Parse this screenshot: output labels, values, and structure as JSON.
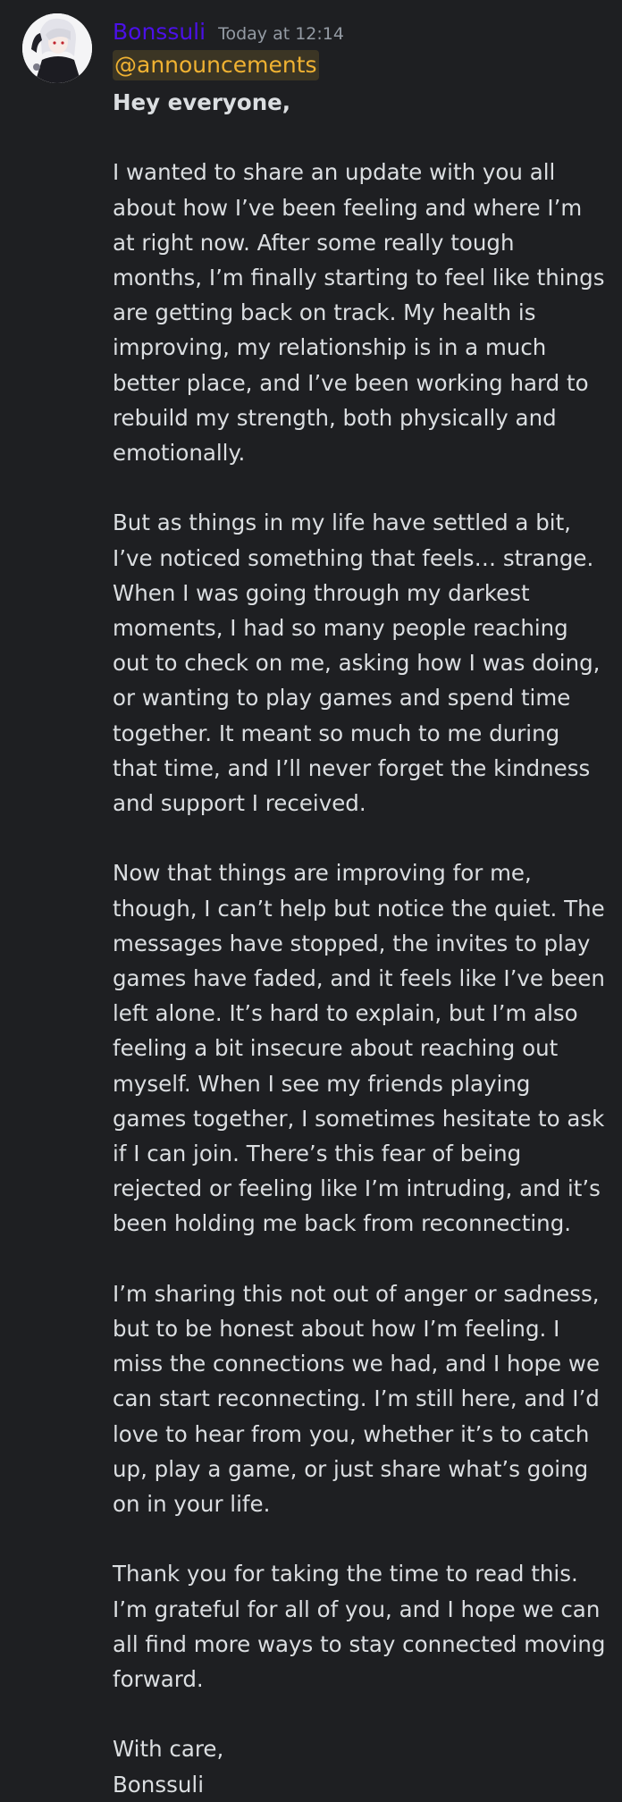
{
  "message": {
    "author": "Bonssuli",
    "timestamp": "Today at 12:14",
    "mention": "@announcements",
    "greeting": "Hey everyone,",
    "paragraphs": [
      "I wanted to share an update with you all about how I’ve been feeling and where I’m at right now. After some really tough months, I’m finally starting to feel like things are getting back on track. My health is improving, my relationship is in a much better place, and I’ve been working hard to rebuild my strength, both physically and emotionally.",
      "But as things in my life have settled a bit, I’ve noticed something that feels… strange. When I was going through my darkest moments, I had so many people reaching out to check on me, asking how I was doing, or wanting to play games and spend time together. It meant so much to me during that time, and I’ll never forget the kindness and support I received.",
      "Now that things are improving for me, though, I can’t help but notice the quiet. The messages have stopped, the invites to play games have faded, and it feels like I’ve been left alone. It’s hard to explain, but I’m also feeling a bit insecure about reaching out myself. When I see my friends playing games together, I sometimes hesitate to ask if I can join. There’s this fear of being rejected or feeling like I’m intruding, and it’s been holding me back from reconnecting.",
      "I’m sharing this not out of anger or sadness, but to be honest about how I’m feeling. I miss the connections we had, and I hope we can start reconnecting. I’m still here, and I’d love to hear from you, whether it’s to catch up, play a game, or just share what’s going on in your life.",
      "Thank you for taking the time to read this. I’m grateful for all of you, and I hope we can all find more ways to stay connected moving forward."
    ],
    "signoff_line1": "With care,",
    "signoff_line2": "Bonssuli"
  },
  "colors": {
    "background": "#1e1f22",
    "username": "#4b10e8",
    "timestamp": "#949ba4",
    "text": "#dbdee1",
    "mention_bg": "#3b3524",
    "mention_text": "#f0b232"
  },
  "icons": {
    "avatar": "anime-character-avatar"
  }
}
